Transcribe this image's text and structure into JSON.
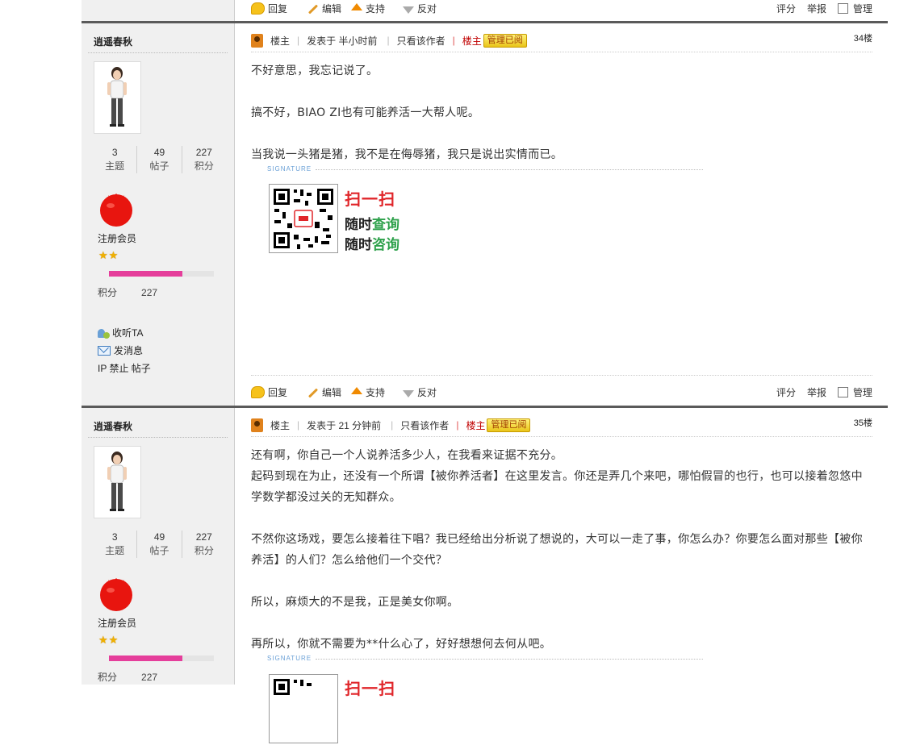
{
  "actions": {
    "reply": "回复",
    "edit": "编辑",
    "support": "支持",
    "oppose": "反对",
    "rate": "评分",
    "report": "举报",
    "manage": "管理"
  },
  "posts": [
    {
      "author": {
        "name": "逍遥春秋",
        "topics": "3",
        "topics_label": "主题",
        "posts": "49",
        "posts_label": "帖子",
        "points": "227",
        "points_label": "积分",
        "rank": "注册会员",
        "stars": "★★",
        "progress": 0.7,
        "points_row_label": "积分",
        "points_row_value": "227",
        "follow": "收听TA",
        "message": "发消息",
        "ip_line": "IP 禁止 帖子"
      },
      "header": {
        "owner_label": "楼主",
        "posted": "发表于 半小时前",
        "only_author": "只看该作者",
        "owner_tag": "楼主",
        "badge": "管理已阅",
        "floor": "34楼"
      },
      "paragraphs": [
        "不好意思，我忘记说了。",
        "",
        "搞不好，BIAO ZI也有可能养活一大帮人呢。",
        "",
        "当我说一头猪是猪，我不是在侮辱猪，我只是说出实情而已。"
      ],
      "signature": {
        "label": "SIGNATURE",
        "scan": "扫一扫",
        "line1_a": "随时",
        "line1_b": "查询",
        "line2_a": "随时",
        "line2_b": "咨询"
      }
    },
    {
      "author": {
        "name": "逍遥春秋",
        "topics": "3",
        "topics_label": "主题",
        "posts": "49",
        "posts_label": "帖子",
        "points": "227",
        "points_label": "积分",
        "rank": "注册会员",
        "stars": "★★",
        "progress": 0.7,
        "points_row_label": "积分",
        "points_row_value": "227"
      },
      "header": {
        "owner_label": "楼主",
        "posted": "发表于 21 分钟前",
        "only_author": "只看该作者",
        "owner_tag": "楼主",
        "badge": "管理已阅",
        "floor": "35楼"
      },
      "paragraphs": [
        "还有啊，你自己一个人说养活多少人，在我看来证据不充分。",
        "起码到现在为止，还没有一个所谓【被你养活者】在这里发言。你还是弄几个来吧，哪怕假冒的也行，也可以接着忽悠中学数学都没过关的无知群众。",
        "",
        "不然你这场戏，要怎么接着往下唱？我已经给出分析说了想说的，大可以一走了事，你怎么办？你要怎么面对那些【被你养活】的人们？怎么给他们一个交代？",
        "",
        "所以，麻烦大的不是我，正是美女你啊。",
        "",
        "再所以，你就不需要为**什么心了，好好想想何去何从吧。"
      ],
      "signature": {
        "label": "SIGNATURE",
        "scan": "扫一扫"
      }
    }
  ]
}
